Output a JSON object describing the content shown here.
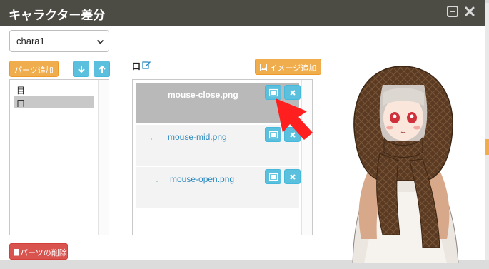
{
  "dialog": {
    "title": "キャラクター差分",
    "minimize_icon": "minimize-icon",
    "close_icon": "close-icon",
    "title_bg": "#4c4c44"
  },
  "character_select": {
    "value": "chara1"
  },
  "parts": {
    "add_label": "パーツ追加",
    "move_down_icon": "arrow-down-icon",
    "move_up_icon": "arrow-up-icon",
    "items": [
      {
        "label": "目",
        "selected": false
      },
      {
        "label": "口",
        "selected": true
      }
    ],
    "delete_label": "パーツの削除"
  },
  "images": {
    "part_label": "口",
    "add_label": "イメージ追加",
    "rows": [
      {
        "name": "mouse-close.png",
        "selected": true
      },
      {
        "name": "mouse-mid.png",
        "selected": false
      },
      {
        "name": "mouse-open.png",
        "selected": false
      }
    ]
  },
  "colors": {
    "orange": "#f0ad4e",
    "blue": "#5bc0de",
    "red": "#d9534f",
    "annotation": "#ff1f1f"
  }
}
